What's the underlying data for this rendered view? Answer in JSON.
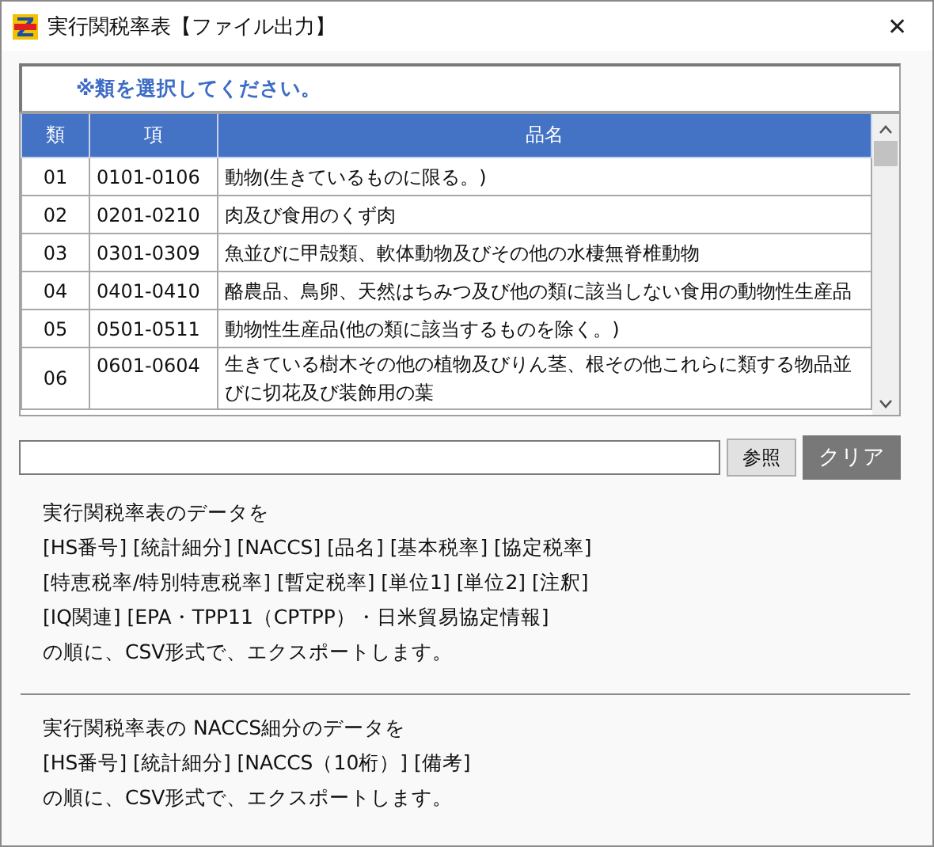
{
  "window": {
    "title": "実行関税率表【ファイル出力】",
    "close": "✕"
  },
  "prompt": "※類を選択してください。",
  "table": {
    "columns": [
      "類",
      "項",
      "品名"
    ],
    "rows": [
      {
        "cells": [
          "01",
          "0101-0106",
          "動物(生きているものに限る。)"
        ]
      },
      {
        "cells": [
          "02",
          "0201-0210",
          "肉及び食用のくず肉"
        ]
      },
      {
        "cells": [
          "03",
          "0301-0309",
          "魚並びに甲殻類、軟体動物及びその他の水棲無脊椎動物"
        ]
      },
      {
        "cells": [
          "04",
          "0401-0410",
          "酪農品、鳥卵、天然はちみつ及び他の類に該当しない食用の動物性生産品"
        ]
      },
      {
        "cells": [
          "05",
          "0501-0511",
          "動物性生産品(他の類に該当するものを除く。)"
        ]
      },
      {
        "cells": [
          "06",
          "0601-0604",
          "生きている樹木その他の植物及びりん茎、根その他これらに類する物品並びに切花及び装飾用の葉"
        ]
      }
    ]
  },
  "buttons": [
    {
      "label": "参照",
      "kind": "normal"
    },
    {
      "label": "クリア",
      "kind": "dark"
    }
  ],
  "sections": [
    {
      "lines": [
        "実行関税率表のデータを",
        "[HS番号] [統計細分] [NACCS] [品名] [基本税率] [協定税率]",
        "[特恵税率/特別特恵税率] [暫定税率] [単位1] [単位2] [注釈]",
        "[IQ関連] [EPA・TPP11（CPTPP）・日米貿易協定情報]",
        "の順に、CSV形式で、エクスポートします。"
      ]
    },
    {
      "lines": [
        "実行関税率表の NACCS細分のデータを",
        "[HS番号] [統計細分] [NACCS（10桁）] [備考]",
        "の順に、CSV形式で、エクスポートします。"
      ]
    }
  ]
}
